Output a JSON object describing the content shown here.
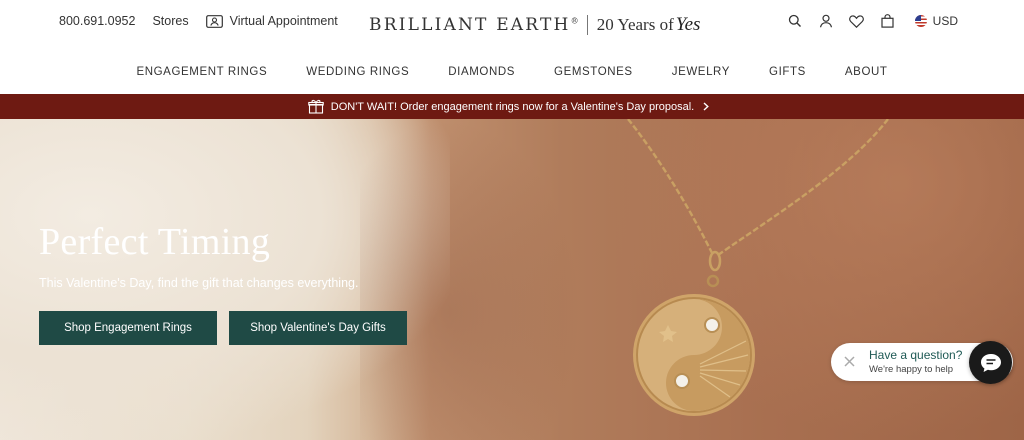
{
  "utility": {
    "phone": "800.691.0952",
    "stores": "Stores",
    "virtual_appointment": "Virtual Appointment"
  },
  "brand": {
    "name": "BRILLIANT EARTH",
    "trademark": "®",
    "tagline_prefix": "20 Years of",
    "tagline_script": "Yes"
  },
  "utility_right": {
    "icons": [
      "search-icon",
      "account-icon",
      "heart-icon",
      "bag-icon"
    ],
    "currency": "USD"
  },
  "nav": {
    "items": [
      "ENGAGEMENT RINGS",
      "WEDDING RINGS",
      "DIAMONDS",
      "GEMSTONES",
      "JEWELRY",
      "GIFTS",
      "ABOUT"
    ]
  },
  "promo": {
    "text": "DON'T WAIT! Order engagement rings now for a Valentine's Day proposal.",
    "background": "#6e1a12"
  },
  "hero": {
    "title": "Perfect Timing",
    "subtitle": "This Valentine's Day, find the gift that changes everything.",
    "buttons": [
      "Shop Engagement Rings",
      "Shop Valentine's Day Gifts"
    ],
    "button_color": "#1f4a45"
  },
  "chat": {
    "question": "Have a question?",
    "subtext": "We're happy to help"
  }
}
